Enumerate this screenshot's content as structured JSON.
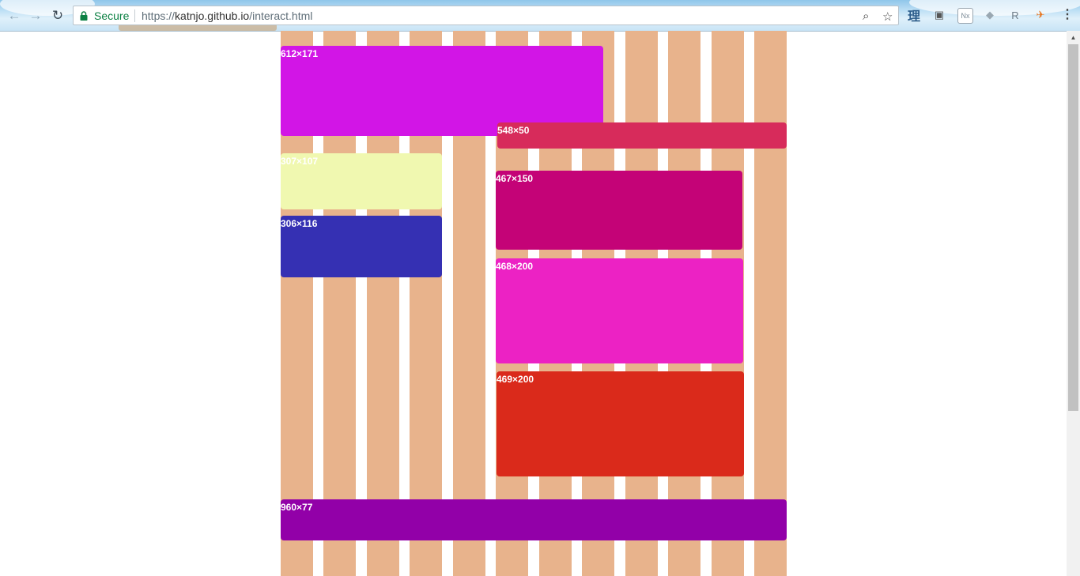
{
  "browser": {
    "secure_label": "Secure",
    "url_scheme": "https://",
    "url_host": "katnjo.github.io",
    "url_path": "/interact.html",
    "back_icon": "←",
    "forward_icon": "→",
    "reload_icon": "↻",
    "zoom_icon": "⌕",
    "star_icon": "☆",
    "menu_icon": "⋮",
    "extensions": [
      {
        "name": "kanji-extension-icon",
        "glyph": "理",
        "color": "#2c5c8a"
      },
      {
        "name": "puzzle-extension-icon",
        "glyph": "▣",
        "color": "#555555"
      },
      {
        "name": "nx-extension-icon",
        "glyph": "Nx",
        "color": "#7a8a96"
      },
      {
        "name": "drop-extension-icon",
        "glyph": "◆",
        "color": "#9aa8b2"
      },
      {
        "name": "r-extension-icon",
        "glyph": "R",
        "color": "#6b7a86"
      },
      {
        "name": "bird-extension-icon",
        "glyph": "✈",
        "color": "#e8731a"
      }
    ]
  },
  "page": {
    "column_color": "#e8b38c",
    "panels": [
      {
        "label": "612×171",
        "color": "#d215e6"
      },
      {
        "label": "548×50",
        "color": "#d72b5b"
      },
      {
        "label": "307×107",
        "color": "#f0f8b0"
      },
      {
        "label": "306×116",
        "color": "#3530b3"
      },
      {
        "label": "467×150",
        "color": "#c40377"
      },
      {
        "label": "468×200",
        "color": "#ec22c4"
      },
      {
        "label": "469×200",
        "color": "#da2a1b"
      },
      {
        "label": "960×77",
        "color": "#9200a8"
      }
    ]
  }
}
